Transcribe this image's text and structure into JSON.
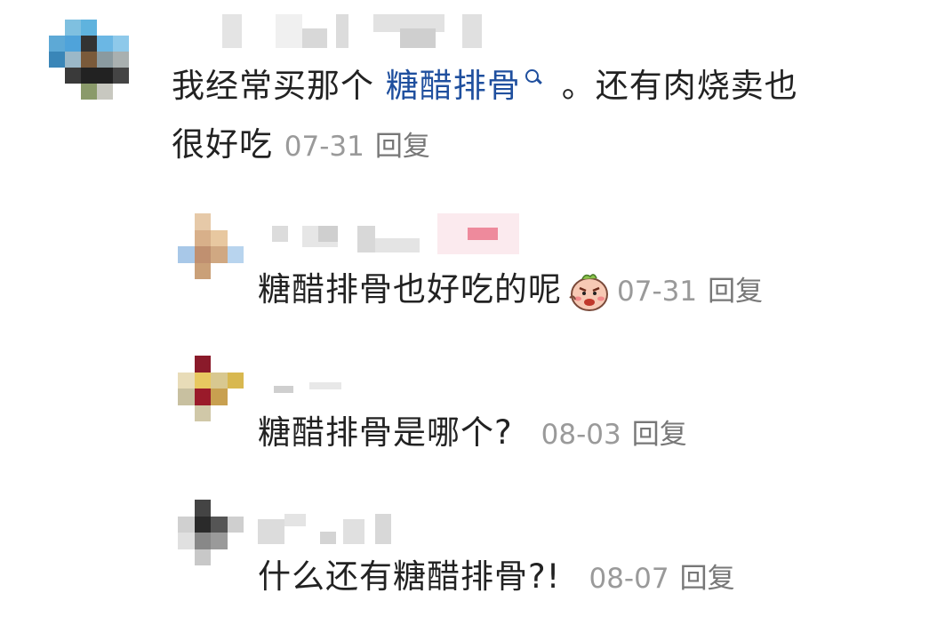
{
  "comments": [
    {
      "text_before": "我经常买那个",
      "link": "糖醋排骨",
      "text_after": "。还有肉烧卖也",
      "text_line2": "很好吃",
      "date": "07-31",
      "reply": "回复"
    },
    {
      "text": "糖醋排骨也好吃的呢",
      "emoji": "angry-face-emoji",
      "date": "07-31",
      "reply": "回复"
    },
    {
      "text": "糖醋排骨是哪个?",
      "date": "08-03",
      "reply": "回复"
    },
    {
      "text": "什么还有糖醋排骨?!",
      "date": "08-07",
      "reply": "回复"
    }
  ],
  "colors": {
    "link": "#1f4f9e",
    "meta": "#9a9a9a",
    "reply": "#777777"
  }
}
